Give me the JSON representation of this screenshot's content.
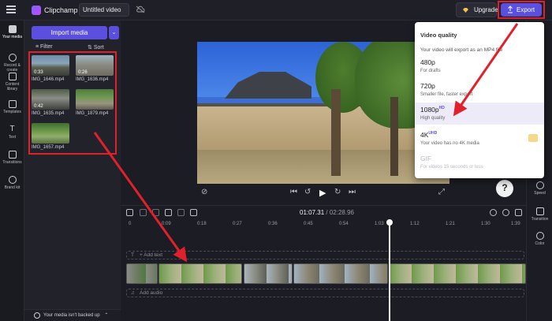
{
  "topbar": {
    "app_name": "Clipchamp",
    "video_title": "Untitled video",
    "upgrade_label": "Upgrade",
    "export_label": "Export"
  },
  "left_rail": {
    "items": [
      {
        "label": "Your media"
      },
      {
        "label": "Record & create"
      },
      {
        "label": "Content library"
      },
      {
        "label": "Templates"
      },
      {
        "label": "Text"
      },
      {
        "label": "Transitions"
      },
      {
        "label": "Brand kit"
      }
    ]
  },
  "media_panel": {
    "import_label": "Import media",
    "filter_label": "Filter",
    "sort_label": "Sort",
    "items": [
      {
        "name": "IMG_1646.mp4",
        "duration": "0:33"
      },
      {
        "name": "IMG_1636.mp4",
        "duration": "0:26"
      },
      {
        "name": "IMG_1635.mp4",
        "duration": "0:42"
      },
      {
        "name": "IMG_1879.mp4",
        "duration": ""
      },
      {
        "name": "IMG_1657.mp4",
        "duration": ""
      }
    ],
    "backup_label": "Your media isn't backed up"
  },
  "export_menu": {
    "heading": "Video quality",
    "description": "Your video will export as an MP4 file",
    "options": [
      {
        "label": "480p",
        "badge": "",
        "sub": "For drafts"
      },
      {
        "label": "720p",
        "badge": "",
        "sub": "Smaller file, faster export"
      },
      {
        "label": "1080p",
        "badge": "HD",
        "sub": "High quality"
      },
      {
        "label": "4K",
        "badge": "UHD",
        "sub": "Your video has no 4K media"
      },
      {
        "label": "GIF",
        "badge": "",
        "sub": "For videos 15 seconds or less"
      }
    ]
  },
  "right_rail": {
    "items": [
      {
        "label": "Speed"
      },
      {
        "label": "Transition"
      },
      {
        "label": "Color"
      }
    ]
  },
  "timeline": {
    "current_time": "01:07.31",
    "total_time": "02:28.96",
    "ruler_ticks": [
      "0",
      "0:09",
      "0:18",
      "0:27",
      "0:36",
      "0:45",
      "0:54",
      "1:03",
      "1:12",
      "1:21",
      "1:30",
      "1:39"
    ],
    "add_text_label": "+ Add text",
    "add_audio_label": "Add audio"
  },
  "colors": {
    "accent": "#5b4fe0",
    "annotation_red": "#e0212b"
  }
}
